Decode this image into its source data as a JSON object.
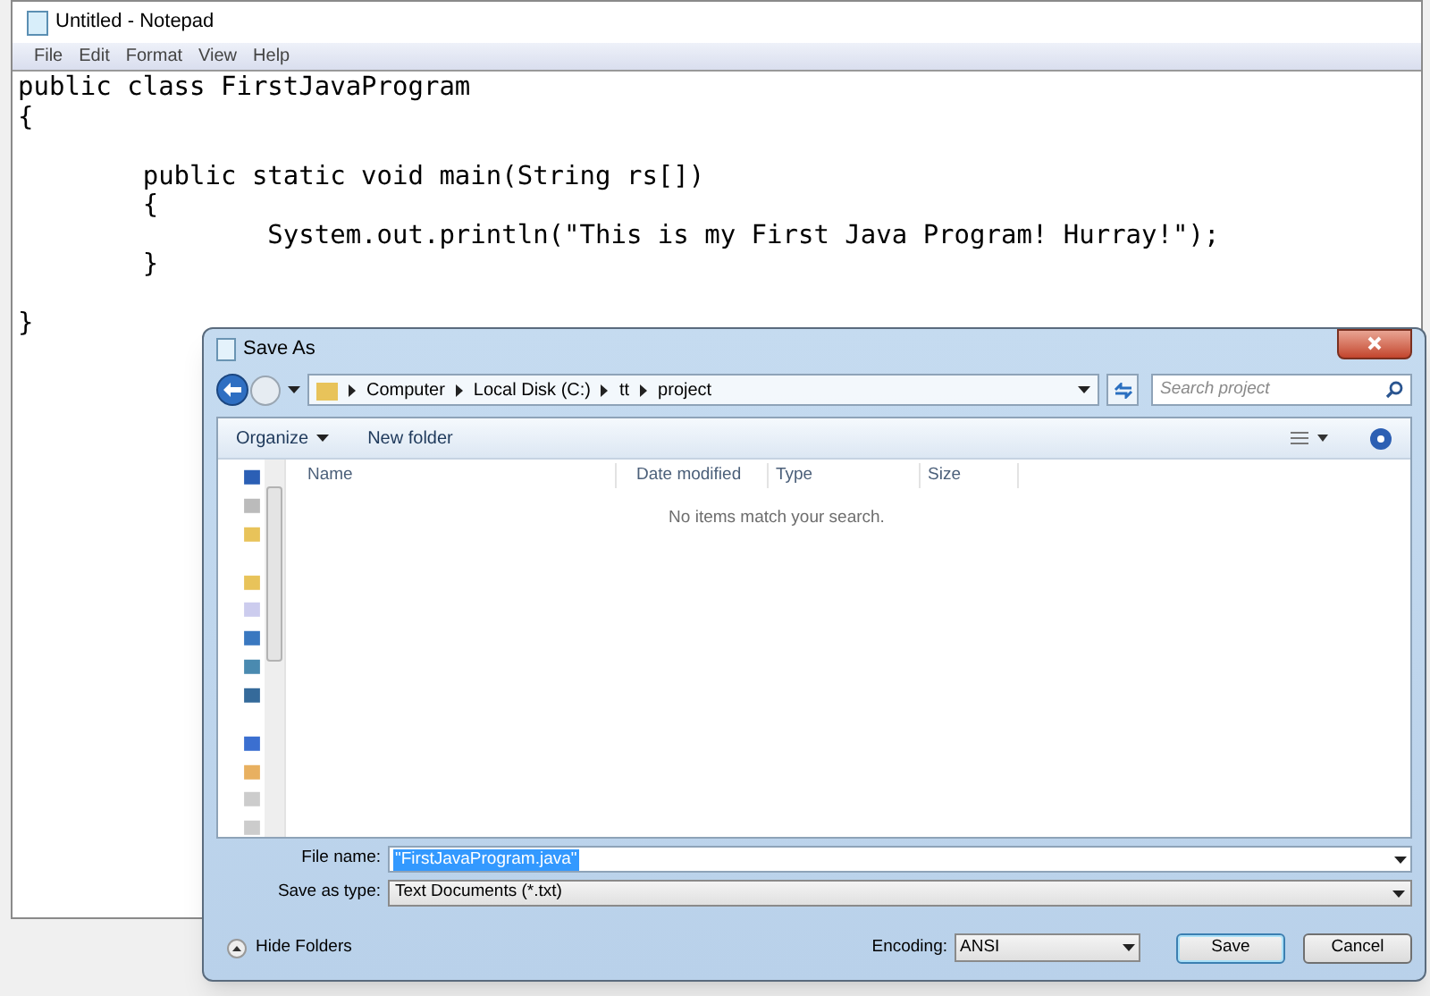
{
  "notepad": {
    "title": "Untitled - Notepad",
    "menu": [
      "File",
      "Edit",
      "Format",
      "View",
      "Help"
    ],
    "text": "public class FirstJavaProgram\n{\n\n        public static void main(String rs[])\n        {\n                System.out.println(\"This is my First Java Program! Hurray!\");\n        }\n\n}"
  },
  "dialog": {
    "title": "Save As",
    "breadcrumb": [
      "Computer",
      "Local Disk (C:)",
      "tt",
      "project"
    ],
    "search": {
      "placeholder": "Search project"
    },
    "toolbar": {
      "organize": "Organize",
      "new_folder": "New folder"
    },
    "columns": [
      "Name",
      "Date modified",
      "Type",
      "Size"
    ],
    "empty_message": "No items match your search.",
    "file_name": {
      "label": "File name:",
      "value": "\"FirstJavaProgram.java\""
    },
    "save_as_type": {
      "label": "Save as type:",
      "value": "Text Documents (*.txt)"
    },
    "hide_folders": "Hide Folders",
    "encoding": {
      "label": "Encoding:",
      "value": "ANSI"
    },
    "buttons": [
      {
        "label": "Save",
        "default": true
      },
      {
        "label": "Cancel",
        "default": false
      }
    ]
  }
}
